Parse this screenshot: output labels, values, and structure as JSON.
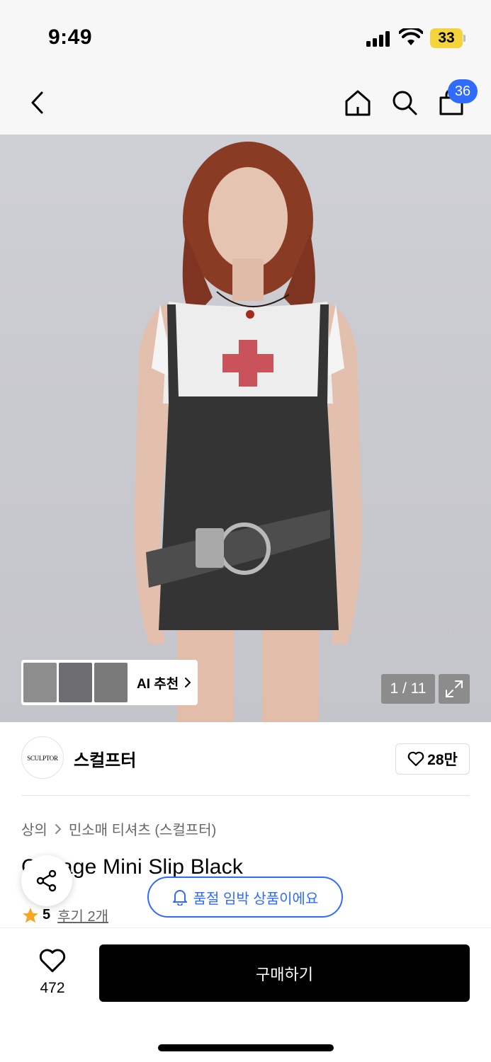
{
  "status": {
    "time": "9:49",
    "battery": "33"
  },
  "nav": {
    "cart_count": "36"
  },
  "gallery": {
    "counter": "1 / 11",
    "ai_label": "AI 추천"
  },
  "brand": {
    "logo_text": "SCULPTOR",
    "name": "스컬프터",
    "likes": "28만"
  },
  "breadcrumb": {
    "category": "상의",
    "subcategory": "민소매 티셔츠 (스컬프터)"
  },
  "product": {
    "title": "Cottage Mini Slip Black",
    "rating": "5",
    "reviews": "후기 2개"
  },
  "alert": {
    "soldout_text": "품절 임박 상품이에요"
  },
  "bottom": {
    "wish_count": "472",
    "buy_label": "구매하기"
  },
  "colors": {
    "accent_blue": "#2f6bff",
    "battery_yellow": "#f5d33a",
    "star_orange": "#f5a623"
  }
}
